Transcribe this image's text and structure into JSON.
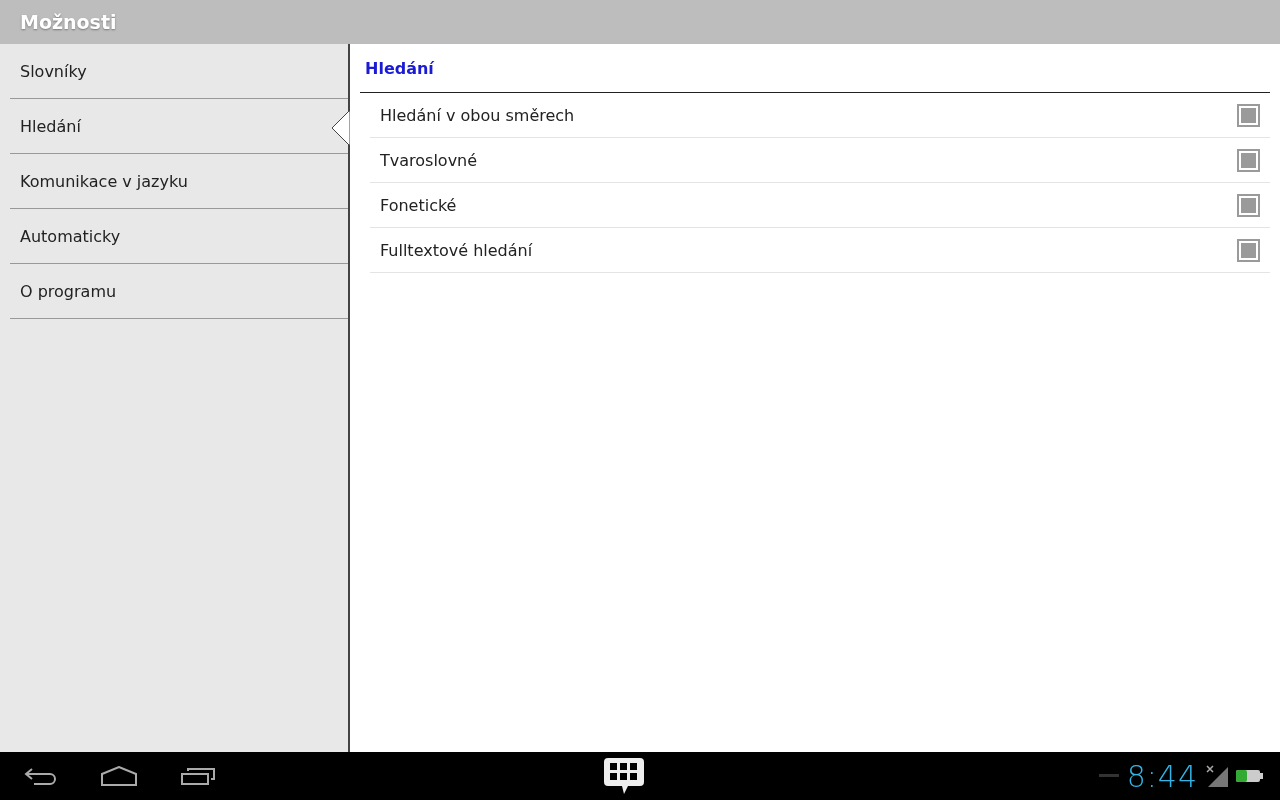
{
  "title_bar": {
    "title": "Možnosti"
  },
  "sidebar": {
    "items": [
      {
        "label": "Slovníky",
        "selected": false
      },
      {
        "label": "Hledání",
        "selected": true
      },
      {
        "label": "Komunikace v jazyku",
        "selected": false
      },
      {
        "label": "Automaticky",
        "selected": false
      },
      {
        "label": "O programu",
        "selected": false
      }
    ]
  },
  "panel": {
    "heading": "Hledání",
    "options": [
      {
        "label": "Hledání v obou směrech",
        "checked": true
      },
      {
        "label": "Tvaroslovné",
        "checked": true
      },
      {
        "label": "Fonetické",
        "checked": true
      },
      {
        "label": "Fulltextové hledání",
        "checked": true
      }
    ]
  },
  "system_bar": {
    "time": "8:44"
  }
}
